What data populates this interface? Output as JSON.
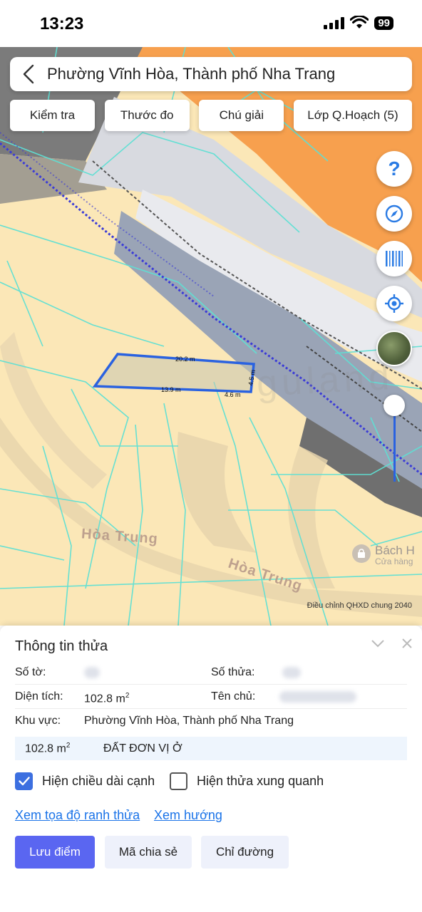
{
  "status_bar": {
    "time": "13:23",
    "battery": "99"
  },
  "header": {
    "location": "Phường Vĩnh Hòa, Thành phố Nha Trang"
  },
  "toolbar": {
    "check_label": "Kiểm tra",
    "measure_label": "Thước đo",
    "legend_label": "Chú giải",
    "layers_label": "Lớp Q.Hoạch (5)"
  },
  "map": {
    "edge_top": "20.2 m",
    "edge_right": "4.5 m",
    "edge_bottom_left": "13.9 m",
    "edge_bottom_right": "4.6 m",
    "street_1": "Hòa Trung",
    "street_2": "Hòa Trung",
    "watermark": "guland",
    "poi_name": "Bách H",
    "poi_sub": "Cửa hàng",
    "plan_note": "Điều chỉnh QHXD chung 2040",
    "help_glyph": "?"
  },
  "panel": {
    "title": "Thông tin thửa",
    "sheet_label": "Số tờ:",
    "parcel_label": "Số thửa:",
    "area_label": "Diện tích:",
    "area_value": "102.8 m",
    "area_unit_sup": "2",
    "owner_label": "Tên chủ:",
    "zone_label": "Khu vực:",
    "zone_value": "Phường Vĩnh Hòa, Thành phố Nha Trang",
    "land_area": "102.8 m",
    "land_area_sup": "2",
    "land_type": "ĐẤT ĐƠN VỊ Ở",
    "show_edges_label": "Hiện chiều dài cạnh",
    "show_edges_checked": true,
    "show_neighbors_label": "Hiện thửa xung quanh",
    "show_neighbors_checked": false,
    "coords_link": "Xem tọa độ ranh thửa",
    "direction_link": "Xem hướng",
    "save_button": "Lưu điểm",
    "share_button": "Mã chia sẻ",
    "directions_button": "Chỉ đường"
  },
  "colors": {
    "accent": "#3c6fe0",
    "primary_button": "#5a66f1",
    "map_residential": "#fbe7b7",
    "map_commercial": "#f7a04e",
    "map_road": "#9aa4b6",
    "parcel_outline": "#2a62e0",
    "cadastral_lines": "#5fe0d4"
  }
}
